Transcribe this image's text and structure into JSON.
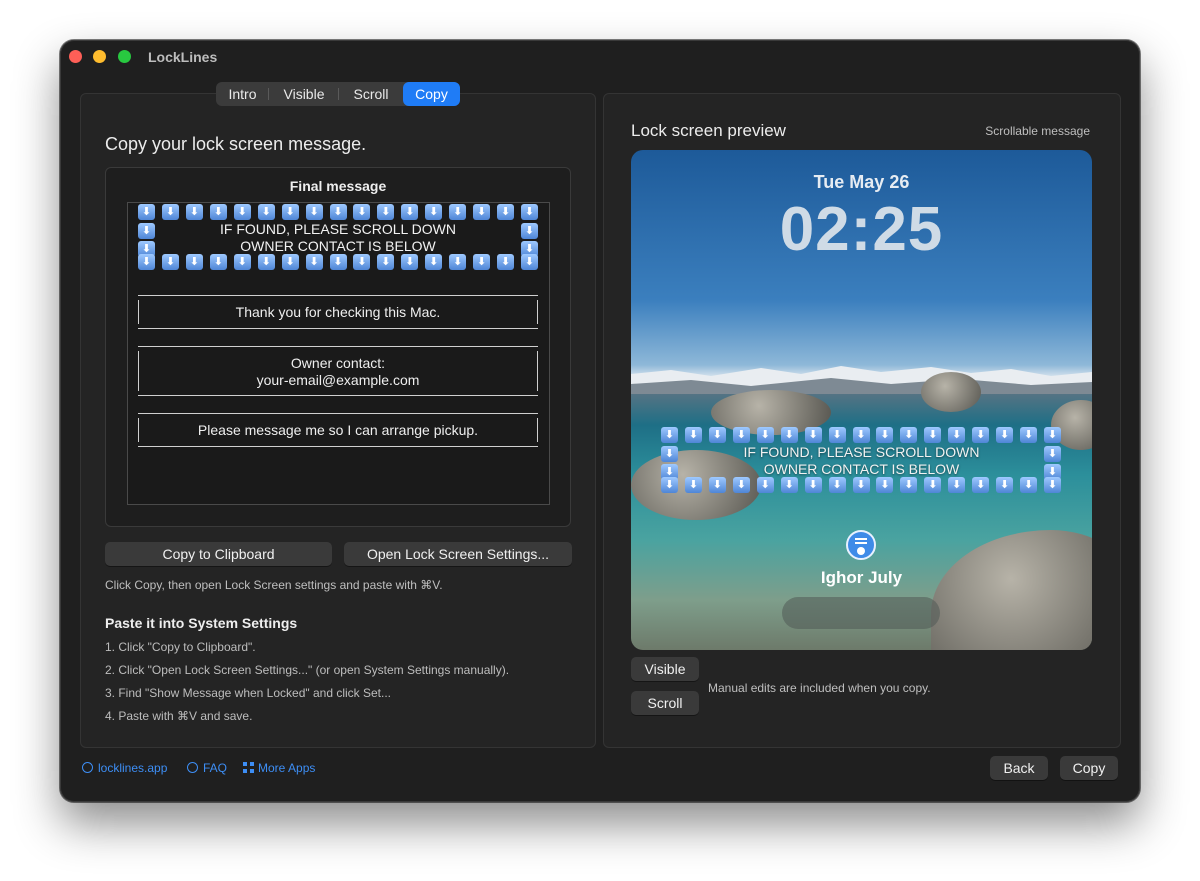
{
  "window": {
    "title": "LockLines"
  },
  "tabs": [
    "Intro",
    "Visible",
    "Scroll",
    "Copy"
  ],
  "active_tab": "Copy",
  "left": {
    "heading": "Copy your lock screen message.",
    "box_title": "Final message",
    "banner_line1": "IF FOUND, PLEASE SCROLL DOWN",
    "banner_line2": "OWNER CONTACT IS BELOW",
    "note1": "Thank you for checking this Mac.",
    "note2_line1": "Owner contact:",
    "note2_line2": "your-email@example.com",
    "note3": "Please message me so I can arrange pickup.",
    "copy_button": "Copy to Clipboard",
    "open_settings_button": "Open Lock Screen Settings...",
    "hint": "Click Copy, then open Lock Screen settings and paste with ⌘V.",
    "paste_heading": "Paste it into System Settings",
    "steps": [
      "1. Click \"Copy to Clipboard\".",
      "2. Click \"Open Lock Screen Settings...\" (or open System Settings manually).",
      "3. Find \"Show Message when Locked\" and click Set...",
      "4. Paste with ⌘V and save."
    ]
  },
  "right": {
    "heading": "Lock screen preview",
    "mode_label": "Scrollable message",
    "date": "Tue May 26",
    "time": "02:25",
    "user_name": "Ighor July",
    "visible_button": "Visible",
    "scroll_button": "Scroll",
    "manual_note": "Manual edits are included when you copy."
  },
  "footer": {
    "site_link": "locklines.app",
    "faq_link": "FAQ",
    "more_apps_link": "More Apps",
    "back_button": "Back",
    "copy_button": "Copy"
  },
  "colors": {
    "accent": "#1f7cf6",
    "link": "#3d8ef5",
    "window_bg": "#1f1f1f"
  },
  "icons": {
    "arrow": "down-arrow-emoji-icon",
    "avatar": "user-avatar-icon",
    "globe": "globe-icon",
    "question": "question-circle-icon",
    "grid": "grid-icon"
  }
}
